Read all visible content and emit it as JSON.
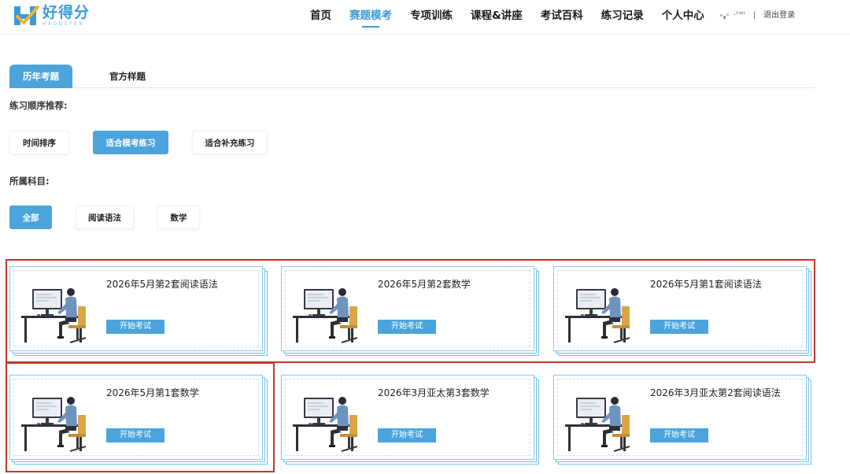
{
  "header": {
    "logo": {
      "cn": "好得分",
      "en": "HAODEFEN"
    },
    "nav": [
      "首页",
      "赛题模考",
      "专项训练",
      "课程&讲座",
      "考试百科",
      "练习记录",
      "个人中心"
    ],
    "active_nav": "赛题模考",
    "user": {
      "name": "·ᶠᴴᴵ",
      "separator": "|",
      "logout": "退出登录"
    }
  },
  "tabs": [
    {
      "label": "历年考题",
      "active": true
    },
    {
      "label": "官方样题",
      "active": false
    }
  ],
  "order_section": {
    "label": "练习顺序推荐:",
    "options": [
      {
        "label": "时间排序",
        "active": false
      },
      {
        "label": "适合模考练习",
        "active": true
      },
      {
        "label": "适合补充练习",
        "active": false
      }
    ]
  },
  "subject_section": {
    "label": "所属科目:",
    "options": [
      {
        "label": "全部",
        "active": true
      },
      {
        "label": "阅读语法",
        "active": false
      },
      {
        "label": "数学",
        "active": false
      }
    ]
  },
  "exams": [
    {
      "title": "2026年5月第2套阅读语法",
      "button": "开始考试"
    },
    {
      "title": "2026年5月第2套数学",
      "button": "开始考试"
    },
    {
      "title": "2026年5月第1套阅读语法",
      "button": "开始考试"
    },
    {
      "title": "2026年5月第1套数学",
      "button": "开始考试"
    },
    {
      "title": "2026年3月亚太第3套数学",
      "button": "开始考试"
    },
    {
      "title": "2026年3月亚太第2套阅读语法",
      "button": "开始考试"
    }
  ],
  "colors": {
    "accent": "#4ba4dc",
    "highlight_border": "#c0392b",
    "card_border": "#8ecbea"
  }
}
